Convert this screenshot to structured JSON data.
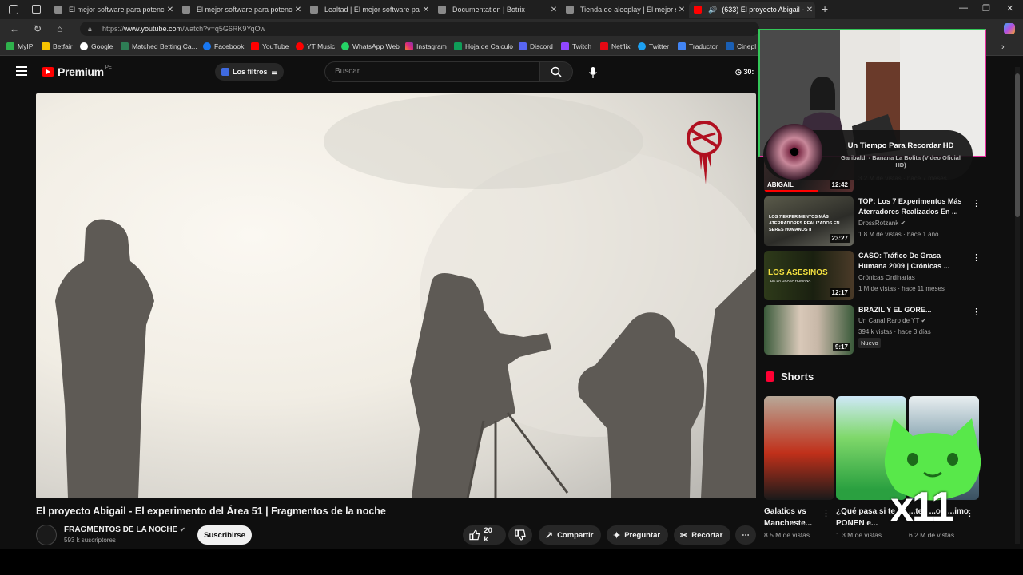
{
  "browser": {
    "tabs": [
      {
        "title": "El mejor software para potenciar"
      },
      {
        "title": "El mejor software para potenciar"
      },
      {
        "title": "Lealtad | El mejor software para p"
      },
      {
        "title": "Documentation | Botrix"
      },
      {
        "title": "Tienda de aleeplay | El mejor softw"
      },
      {
        "title": "(633) El proyecto Abigail - El"
      }
    ],
    "url_prefix": "https://",
    "url_host": "www.youtube.com",
    "url_path": "/watch?v=q5G6RK9YqOw",
    "bookmarks": [
      "MyIP",
      "Betfair",
      "Google",
      "Matched Betting Ca...",
      "Facebook",
      "YouTube",
      "YT Music",
      "WhatsApp Web",
      "Instagram",
      "Hoja de Calculo",
      "Discord",
      "Twitch",
      "Netflix",
      "Twitter",
      "Traductor",
      "Cinepl"
    ]
  },
  "youtube": {
    "logo": "Premium",
    "country": "PE",
    "filters_label": "Los filtros",
    "search_placeholder": "Buscar",
    "timer": "30:"
  },
  "video": {
    "title": "El proyecto Abigail - El experimento del Área 51 | Fragmentos de la noche",
    "channel": "FRAGMENTOS DE LA NOCHE",
    "subscribers": "593 k suscriptores",
    "subscribe_label": "Suscribirse",
    "likes": "20 k",
    "share": "Compartir",
    "ask": "Preguntar",
    "clip": "Recortar",
    "thumb_text": "ABIGAIL"
  },
  "recommendations": [
    {
      "title": "",
      "channel": "",
      "meta": "3.2 M de vistas · hace 7 meses",
      "duration": "12:42"
    },
    {
      "title": "TOP: Los 7 Experimentos Más Aterradores Realizados En ...",
      "channel": "DrossRotzank",
      "meta": "1.8 M de vistas · hace 1 año",
      "duration": "23:27",
      "thumb_text": "LOS 7 EXPERIMENTOS MÁS ATERRADORES REALIZADOS EN SERES HUMANOS II"
    },
    {
      "title": "CASO: Tráfico De Grasa Humana 2009 | Crónicas ...",
      "channel": "Crónicas Ordinarias",
      "meta": "1 M de vistas · hace 11 meses",
      "duration": "12:17",
      "thumb_text": "LOS ASESINOS",
      "thumb_sub": "DE LA GRASA HUMANA"
    },
    {
      "title": "BRAZIL Y EL GORE...",
      "channel": "Un Canal Raro de YT",
      "meta": "394 k vistas · hace 3 días",
      "duration": "9:17",
      "badge": "Nuevo"
    }
  ],
  "shorts": {
    "heading": "Shorts",
    "items": [
      {
        "title": "Galatics vs Mancheste...",
        "views": "8.5 M de vistas"
      },
      {
        "title": "¿Qué pasa si te PONEN e...",
        "views": "1.3 M de vistas"
      },
      {
        "title": "...tes ...ou ...imo",
        "views": "6.2 M de vistas"
      }
    ]
  },
  "now_playing": {
    "title": "Un Tiempo Para Recordar HD",
    "subtitle": "Garibaldi - Banana La Bolita (Video Oficial HD)"
  },
  "overlay": {
    "counter": "x11"
  },
  "colors": {
    "brand_red": "#ff0000",
    "shorts_red": "#ff0033",
    "cam_border_pink": "#e62e9e",
    "cam_border_green": "#34c759",
    "cat_green": "#58e84a"
  }
}
